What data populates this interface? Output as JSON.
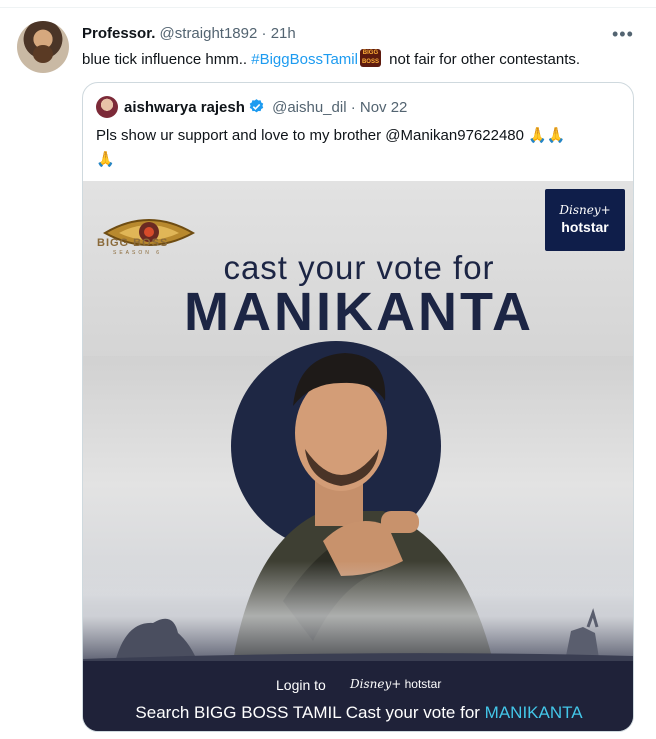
{
  "tweet": {
    "display_name": "Professor.",
    "handle": "@straight1892",
    "separator": "·",
    "time": "21h",
    "more_icon": "more-horizontal-icon",
    "text_before": "blue tick influence hmm.. ",
    "hashtag": "#BiggBossTamil",
    "hashtag_emoji_icon": "bigg-boss-emoji-icon",
    "text_after": " not fair for other contestants."
  },
  "quote": {
    "display_name": "aishwarya rajesh",
    "verified_icon": "verified-badge-icon",
    "handle": "@aishu_dil",
    "separator": "·",
    "date": "Nov 22",
    "text": "Pls show ur support and love to my brother @Manikan97622480",
    "emoji": "🙏🙏",
    "emoji_line2": "🙏"
  },
  "poster": {
    "logo_text": "BIGG BOSS",
    "season_text": "SEASON 6",
    "badge_disney": "Disney+",
    "badge_hotstar": "hotstar",
    "headline_1": "cast your vote for",
    "headline_2": "MANIKANTA",
    "login_prefix": "Login to",
    "login_logo_disney": "Disney+",
    "login_logo_hotstar": "hotstar",
    "search_prefix": "Search BIGG BOSS TAMIL Cast your vote for ",
    "search_name": "MANIKANTA"
  },
  "colors": {
    "link": "#1d9bf0",
    "muted": "#536471",
    "poster_navy": "#1c2544",
    "name_accent": "#43c6e8"
  }
}
